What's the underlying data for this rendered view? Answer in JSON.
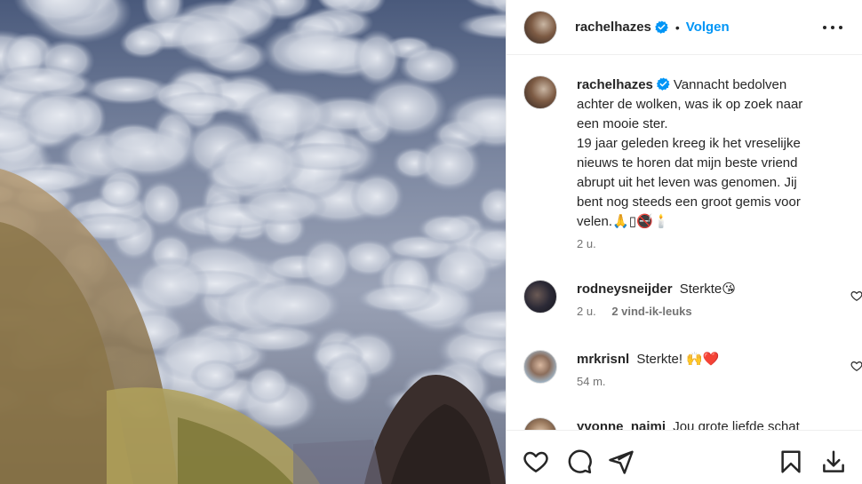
{
  "post": {
    "username": "rachelhazes",
    "follow_label": "Volgen",
    "dot": "•",
    "icons": {
      "verified": "verified-badge-icon",
      "more": "more-options-icon",
      "like": "heart-icon",
      "comment": "comment-icon",
      "share": "share-icon",
      "save": "bookmark-icon",
      "download": "download-icon"
    },
    "accent_color": "#0095f6",
    "verified_color": "#0095f6"
  },
  "caption": {
    "username": "rachelhazes",
    "line1": "Vannacht bedolven achter de wolken, was ik op zoek naar een mooie ster.",
    "line2": "19 jaar geleden kreeg ik het vreselijke nieuws te horen dat mijn beste vriend abrupt uit het leven was genomen. Jij bent nog steeds een groot gemis voor velen.🙏▯🚭🕯️",
    "time": "2 u."
  },
  "comments": [
    {
      "username": "rodneysneijder",
      "text": "Sterkte😘",
      "time": "2 u.",
      "likes": "2 vind-ik-leuks"
    },
    {
      "username": "mrkrisnl",
      "text": "Sterkte! 🙌❤️",
      "time": "54 m.",
      "likes": ""
    },
    {
      "username": "yvonne_naimi",
      "text": "Jou grote liefde schat",
      "time": "",
      "likes": ""
    }
  ]
}
